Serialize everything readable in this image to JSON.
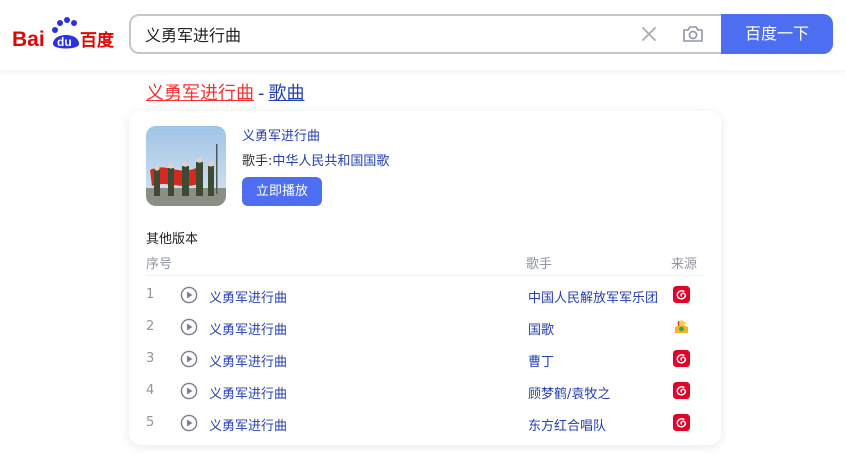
{
  "header": {
    "logo_text_left": "Bai",
    "logo_text_mid": "du",
    "logo_text_right": "百度",
    "search_value": "义勇军进行曲",
    "search_button": "百度一下"
  },
  "result": {
    "title_keyword": "义勇军进行曲",
    "title_separator": "-",
    "title_category": "歌曲"
  },
  "card": {
    "song_name": "义勇军进行曲",
    "singer_label": "歌手:",
    "singer_value": "中华人民共和国国歌",
    "play_button": "立即播放",
    "other_versions_label": "其他版本",
    "columns": {
      "index": "序号",
      "singer": "歌手",
      "source": "来源"
    },
    "rows": [
      {
        "index": "1",
        "name": "义勇军进行曲",
        "singer": "中国人民解放军军乐团",
        "source_icon": "netease-music-icon"
      },
      {
        "index": "2",
        "name": "义勇军进行曲",
        "singer": "国歌",
        "source_icon": "music-app-icon"
      },
      {
        "index": "3",
        "name": "义勇军进行曲",
        "singer": "曹丁",
        "source_icon": "netease-music-icon"
      },
      {
        "index": "4",
        "name": "义勇军进行曲",
        "singer": "顾梦鹤/袁牧之",
        "source_icon": "netease-music-icon"
      },
      {
        "index": "5",
        "name": "义勇军进行曲",
        "singer": "东方红合唱队",
        "source_icon": "netease-music-icon"
      }
    ]
  },
  "colors": {
    "brand_blue": "#4e6ef2",
    "link_blue": "#2440b3",
    "highlight_red": "#f73131",
    "logo_red": "#e10602",
    "logo_blue": "#2932e1",
    "netease_red": "#e60026"
  }
}
